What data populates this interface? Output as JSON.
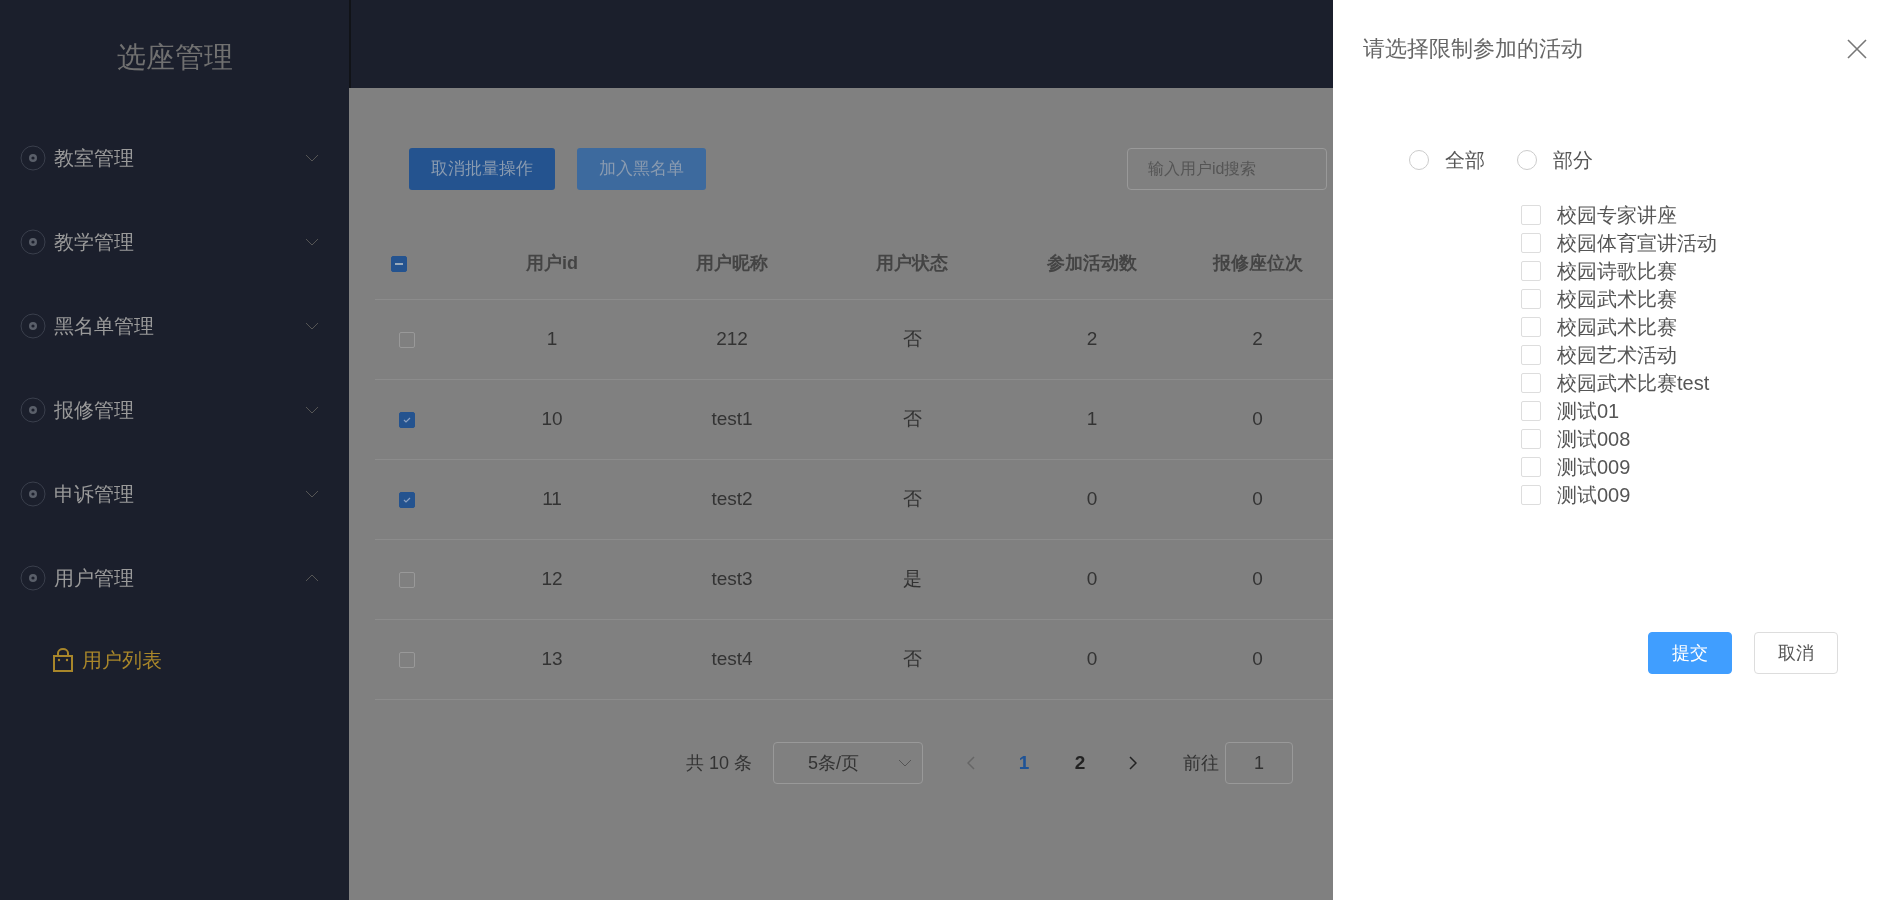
{
  "sidebar": {
    "title": "选座管理",
    "menu": [
      {
        "label": "教室管理",
        "expanded": false
      },
      {
        "label": "教学管理",
        "expanded": false
      },
      {
        "label": "黑名单管理",
        "expanded": false
      },
      {
        "label": "报修管理",
        "expanded": false
      },
      {
        "label": "申诉管理",
        "expanded": false
      },
      {
        "label": "用户管理",
        "expanded": true,
        "children": [
          {
            "label": "用户列表",
            "selected": true
          }
        ]
      }
    ]
  },
  "toolbar": {
    "buttons": [
      "取消批量操作",
      "加入黑名单"
    ],
    "search": {
      "placeholder": "输入用户id搜索"
    }
  },
  "table": {
    "header_indeterminate": true,
    "columns": [
      "用户id",
      "用户昵称",
      "用户状态",
      "参加活动数",
      "报修座位次"
    ],
    "rows": [
      {
        "selected": false,
        "cells": [
          "1",
          "212",
          "否",
          "2",
          "2"
        ]
      },
      {
        "selected": true,
        "cells": [
          "10",
          "test1",
          "否",
          "1",
          "0"
        ]
      },
      {
        "selected": true,
        "cells": [
          "11",
          "test2",
          "否",
          "0",
          "0"
        ]
      },
      {
        "selected": false,
        "cells": [
          "12",
          "test3",
          "是",
          "0",
          "0"
        ]
      },
      {
        "selected": false,
        "cells": [
          "13",
          "test4",
          "否",
          "0",
          "0"
        ]
      }
    ]
  },
  "pagination": {
    "total": "共 10 条",
    "page_size": "5条/页",
    "pages": [
      {
        "label": "1",
        "selected": true
      },
      {
        "label": "2",
        "selected": false
      }
    ],
    "goto_label": "前往",
    "goto_value": "1"
  },
  "drawer": {
    "title": "请选择限制参加的活动",
    "radios": [
      {
        "label": "全部",
        "selected": false
      },
      {
        "label": "部分",
        "selected": false
      }
    ],
    "activities": [
      {
        "label": "校园专家讲座",
        "checked": false
      },
      {
        "label": "校园体育宣讲活动",
        "checked": false
      },
      {
        "label": "校园诗歌比赛",
        "checked": false
      },
      {
        "label": "校园武术比赛",
        "checked": false
      },
      {
        "label": "校园武术比赛",
        "checked": false
      },
      {
        "label": "校园艺术活动",
        "checked": false
      },
      {
        "label": "校园武术比赛test",
        "checked": false
      },
      {
        "label": "测试01",
        "checked": false
      },
      {
        "label": "测试008",
        "checked": false
      },
      {
        "label": "测试009",
        "checked": false
      },
      {
        "label": "测试009",
        "checked": false
      }
    ],
    "buttons": [
      {
        "label": "提交",
        "kind": "primary"
      },
      {
        "label": "取消",
        "kind": "default"
      }
    ]
  }
}
